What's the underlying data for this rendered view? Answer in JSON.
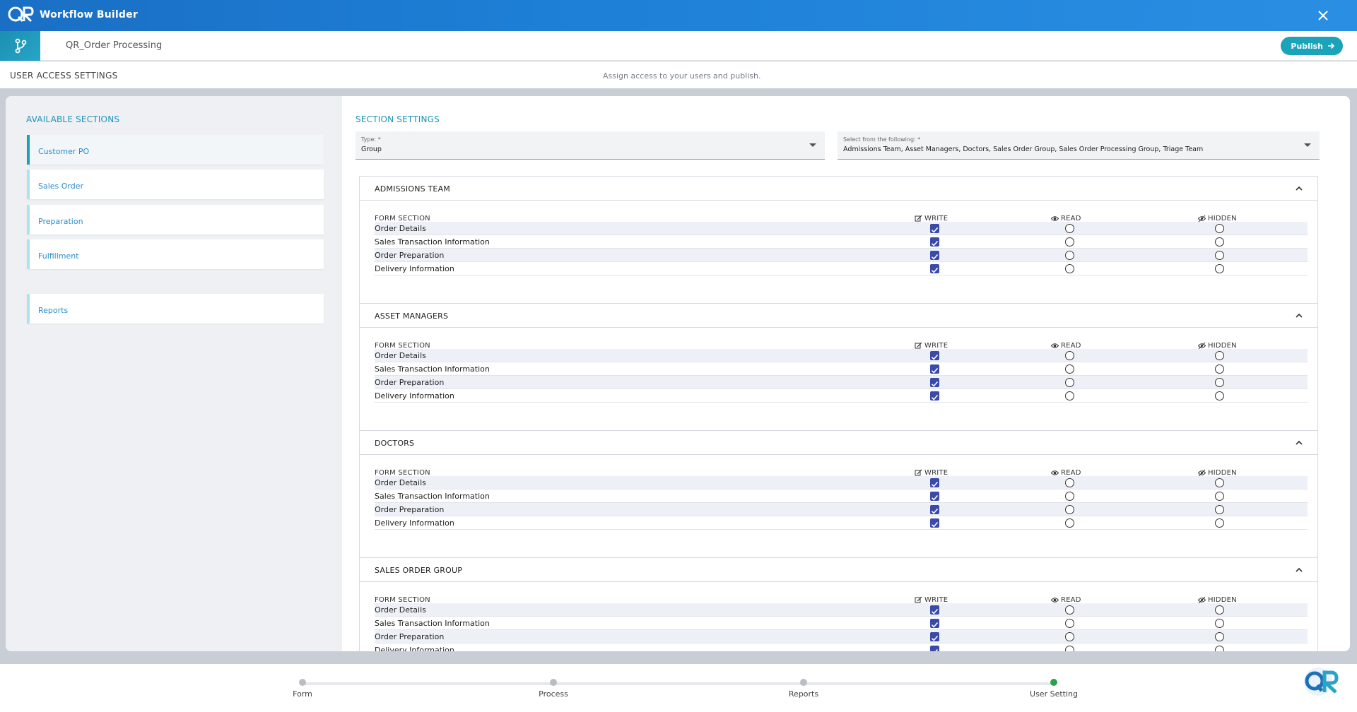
{
  "app": {
    "title": "Workflow Builder",
    "workflow_name": "QR_Order Processing",
    "publish_label": "Publish"
  },
  "access": {
    "title": "USER ACCESS SETTINGS",
    "subtitle": "Assign access to your users and publish."
  },
  "left": {
    "title": "AVAILABLE SECTIONS",
    "sections": [
      "Customer PO",
      "Sales Order",
      "Preparation",
      "Fulfillment"
    ],
    "reports": "Reports"
  },
  "right": {
    "title": "SECTION SETTINGS",
    "type_caption": "Type: *",
    "type_value": "Group",
    "select_caption": "Select from the following: *",
    "select_value": "Admissions Team, Asset Managers, Doctors, Sales Order Group, Sales Order Processing Group, Triage Team"
  },
  "columns": {
    "form_section": "FORM SECTION",
    "write": "WRITE",
    "read": "READ",
    "hidden": "HIDDEN"
  },
  "groups": [
    {
      "title": "ADMISSIONS TEAM",
      "rows": [
        "Order Details",
        "Sales Transaction Information",
        "Order Preparation",
        "Delivery Information"
      ]
    },
    {
      "title": "ASSET MANAGERS",
      "rows": [
        "Order Details",
        "Sales Transaction Information",
        "Order Preparation",
        "Delivery Information"
      ]
    },
    {
      "title": "DOCTORS",
      "rows": [
        "Order Details",
        "Sales Transaction Information",
        "Order Preparation",
        "Delivery Information"
      ]
    },
    {
      "title": "SALES ORDER GROUP",
      "rows": [
        "Order Details",
        "Sales Transaction Information",
        "Order Preparation",
        "Delivery Information"
      ]
    }
  ],
  "steps": {
    "items": [
      "Form",
      "Process",
      "Reports",
      "User Setting"
    ],
    "current_index": 3
  },
  "colors": {
    "brand_blue": "#1d7fd6",
    "accent_teal": "#1aa3b9",
    "checkbox": "#3b4aa8",
    "done_step": "#2aa14b"
  }
}
